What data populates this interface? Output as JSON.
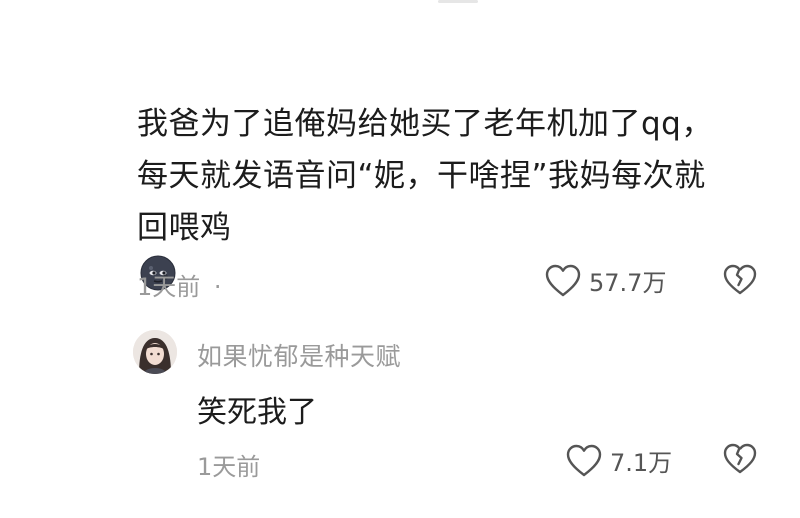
{
  "comment": {
    "lines": [
      "我爸为了追俺妈给她买了老年机加了qq，",
      "每天就发语音问“妮，干啥捏”我妈每次就",
      "回喂鸡"
    ],
    "time": "1天前",
    "separator": "·",
    "likes": "57.7万",
    "emoji_icon": "new-moon-face-emoji"
  },
  "reply": {
    "username": "如果忧郁是种天赋",
    "text": "笑死我了",
    "time": "1天前",
    "likes": "7.1万"
  },
  "icons": {
    "like": "heart-outline-icon",
    "dislike": "broken-heart-icon"
  },
  "colors": {
    "text": "#1c1c1c",
    "meta": "#9a9a9a",
    "icon": "#555555"
  }
}
